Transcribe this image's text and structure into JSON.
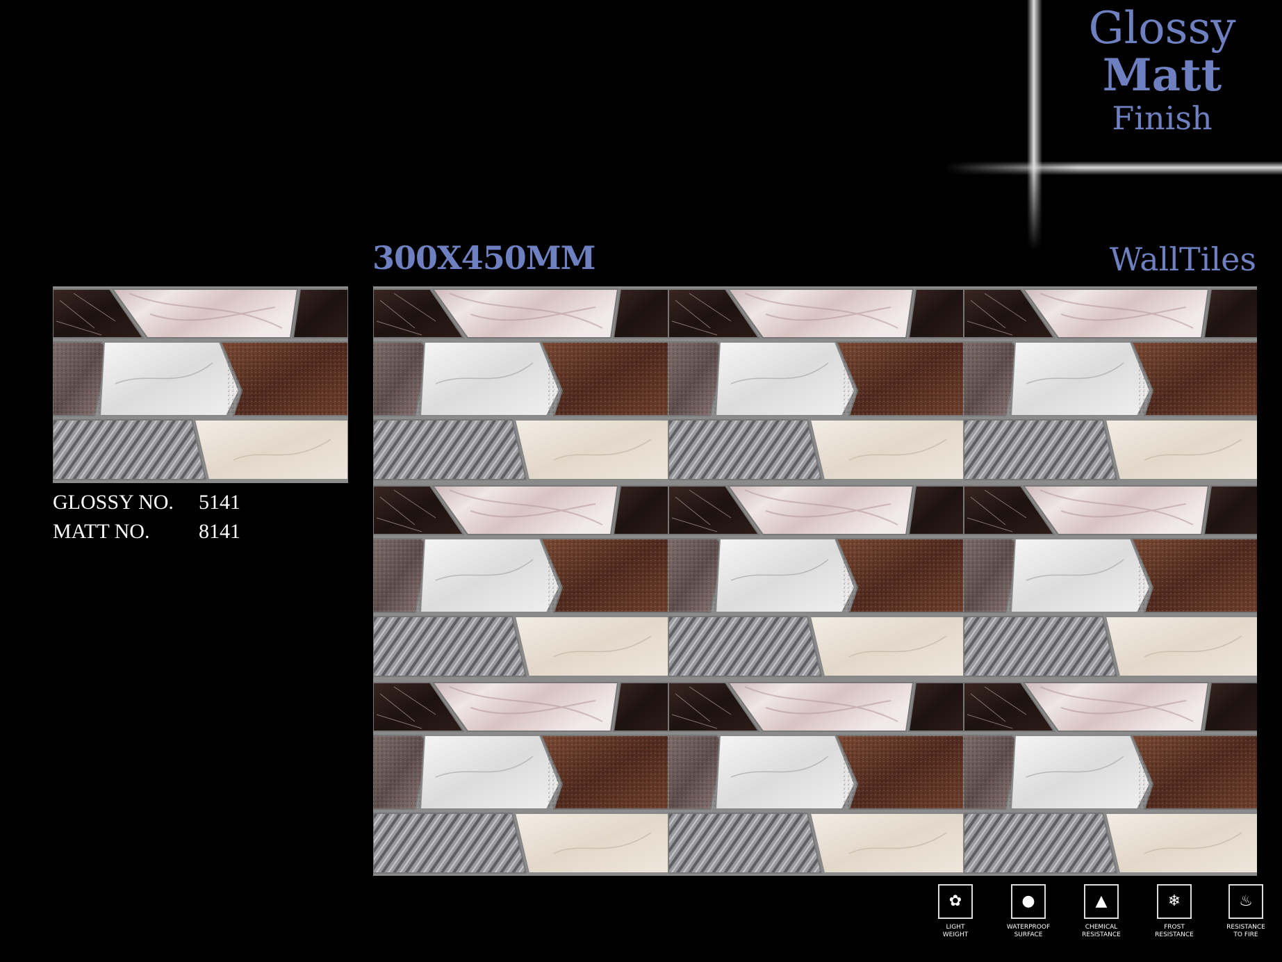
{
  "finish": {
    "line1": "Glossy",
    "line2": "Matt",
    "line3": "Finish"
  },
  "size": "300X450MM",
  "category": "WallTiles",
  "codes": {
    "glossy_label": "GLOSSY NO.",
    "glossy_value": "5141",
    "matt_label": "MATT NO.",
    "matt_value": "8141"
  },
  "features": [
    {
      "icon": "feather-icon",
      "line1": "LIGHT",
      "line2": "WEIGHT"
    },
    {
      "icon": "water-drop-icon",
      "line1": "WATERPROOF",
      "line2": "SURFACE"
    },
    {
      "icon": "flask-icon",
      "line1": "CHEMICAL",
      "line2": "RESISTANCE"
    },
    {
      "icon": "snowflake-icon",
      "line1": "FROST",
      "line2": "RESISTANCE"
    },
    {
      "icon": "flame-icon",
      "line1": "RESISTANCE",
      "line2": "TO FIRE"
    }
  ],
  "colors": {
    "accent": "#6f80c0",
    "dark_marble": "#2a1a18",
    "pink_marble": "#e6d8d8",
    "granite": "#6e5a52",
    "white_marble": "#ececec",
    "rust_granite": "#6a3a28",
    "striped_grey": "#8a8a8e",
    "cream_stone": "#e9e2d6"
  }
}
